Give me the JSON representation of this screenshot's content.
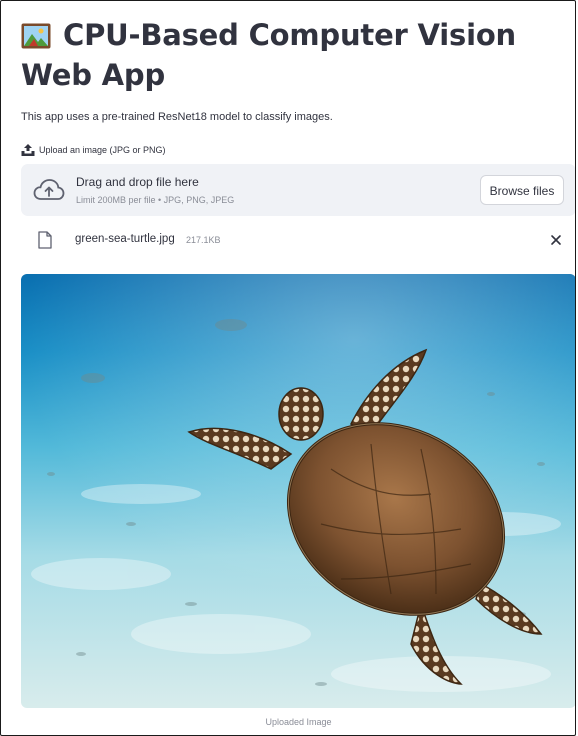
{
  "header": {
    "title": "CPU-Based Computer Vision Web App",
    "emoji_icon": "framed-picture-icon"
  },
  "description": "This app uses a pre-trained ResNet18 model to classify images.",
  "uploader": {
    "label": "Upload an image (JPG or PNG)",
    "label_icon": "upload-tray-icon",
    "drop_title": "Drag and drop file here",
    "drop_subtitle": "Limit 200MB per file • JPG, PNG, JPEG",
    "browse_label": "Browse files",
    "cloud_icon": "cloud-upload-icon"
  },
  "uploaded_file": {
    "name": "green-sea-turtle.jpg",
    "size": "217.1KB",
    "file_icon": "file-icon",
    "remove_icon": "close-icon"
  },
  "image": {
    "caption": "Uploaded Image",
    "subject": "green sea turtle swimming over sandy sea floor"
  },
  "colors": {
    "text": "#31333f",
    "muted": "#8a8d97",
    "dropzone_bg": "#f0f2f6",
    "water": "#1f8fc4"
  }
}
